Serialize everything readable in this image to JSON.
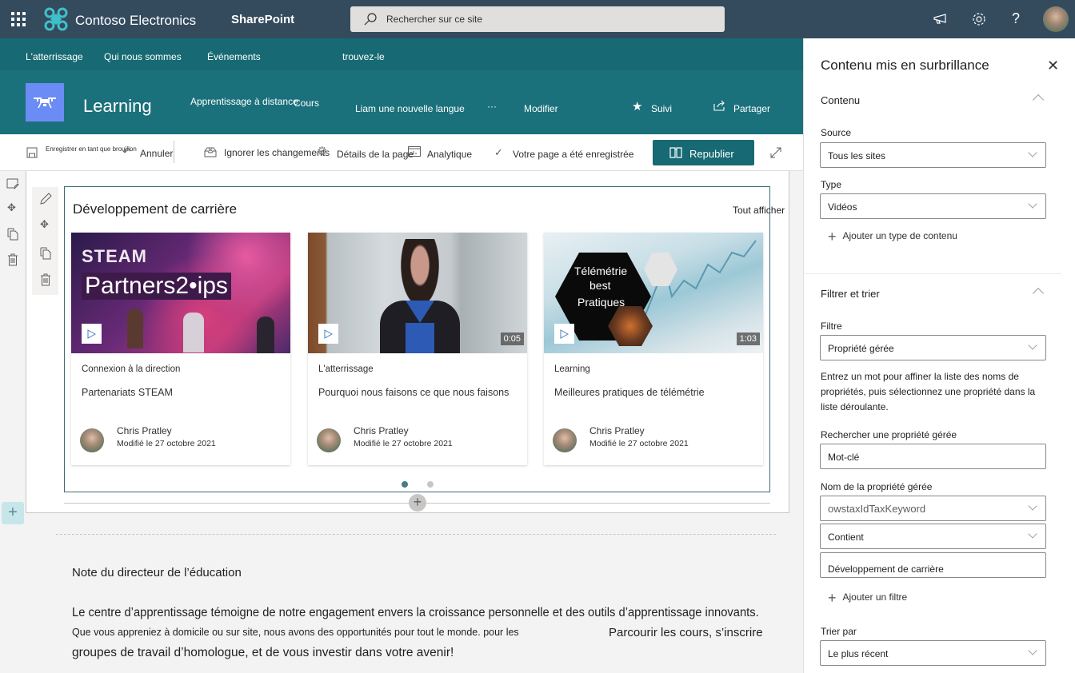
{
  "suite": {
    "org_name": "Contoso Electronics",
    "app_name": "SharePoint",
    "search_placeholder": "Rechercher sur ce site",
    "icons": [
      "waffle-icon",
      "megaphone-icon",
      "gear-icon",
      "help-icon",
      "avatar"
    ]
  },
  "nav": {
    "items": [
      "L'atterrissage",
      "Qui nous sommes",
      "Événements",
      "trouvez-le"
    ]
  },
  "site_header": {
    "title": "Learning",
    "links": [
      "Apprentissage à distance",
      "Cours",
      "Liam une nouvelle langue"
    ],
    "more": "···",
    "edit": "Modifier",
    "follow": "Suivi",
    "share": "Partager"
  },
  "command_bar": {
    "save_draft": "Enregistrer en tant que brouillon",
    "undo": "Annuler",
    "discard": "Ignorer les changements",
    "page_details": "Détails de la page",
    "analytics": "Analytique",
    "saved_status": "Votre page a été enregistrée",
    "republish": "Republier"
  },
  "webpart": {
    "title": "Développement de carrière",
    "see_all": "Tout afficher",
    "cards": [
      {
        "thumb_title": "STEAM",
        "thumb_subtitle": "Partners2•ips",
        "duration": "",
        "site": "Connexion à la direction",
        "title": "Partenariats STEAM",
        "author": "Chris Pratley",
        "modified": "Modifié le 27 octobre 2021"
      },
      {
        "thumb_title": "",
        "thumb_subtitle": "",
        "duration": "0:05",
        "site": "L'atterrissage",
        "title": "Pourquoi nous faisons ce que nous faisons",
        "author": "Chris Pratley",
        "modified": "Modifié le 27 octobre 2021"
      },
      {
        "thumb_title": "Télémétrie",
        "thumb_subtitle": "best",
        "thumb_subtitle2": "Pratiques",
        "duration": "1:03",
        "site": "Learning",
        "title": "Meilleures pratiques de télémétrie",
        "author": "Chris Pratley",
        "modified": "Modifié le 27 octobre 2021"
      }
    ],
    "pages": 2,
    "current_page": 1
  },
  "text_section": {
    "heading": "Note du directeur de l’éducation",
    "line1": "Le centre d’apprentissage témoigne de notre engagement envers la croissance personnelle et des outils d’apprentissage innovants.",
    "line2": "Que vous appreniez à domicile ou sur site, nous avons des opportunités pour tout le monde. pour les",
    "line2b": "Parcourir les cours, s’inscrire",
    "line3": "groupes de travail d’homologue, et de vous investir dans votre avenir!"
  },
  "panel": {
    "title": "Contenu mis en surbrillance",
    "content_section": "Contenu",
    "source_label": "Source",
    "source_value": "Tous les sites",
    "type_label": "Type",
    "type_value": "Vidéos",
    "add_content_type": "Ajouter un type de contenu",
    "filter_section": "Filtrer et trier",
    "filter_label": "Filtre",
    "filter_value": "Propriété gérée",
    "filter_help": "Entrez un mot pour affiner la liste des noms de propriétés, puis sélectionnez une propriété dans la liste déroulante.",
    "search_prop_label": "Rechercher une propriété gérée",
    "search_prop_value": "Mot-clé",
    "prop_name_label": "Nom de la propriété gérée",
    "prop_name_value": "owstaxIdTaxKeyword",
    "operator_value": "Contient",
    "filter_text_value": "Développement de carrière",
    "add_filter": "Ajouter un filtre",
    "sort_label": "Trier par",
    "sort_value": "Le plus récent"
  },
  "colors": {
    "suite": "#344b5e",
    "theme": "#176a73",
    "site_logo": "#6b8cf5"
  }
}
